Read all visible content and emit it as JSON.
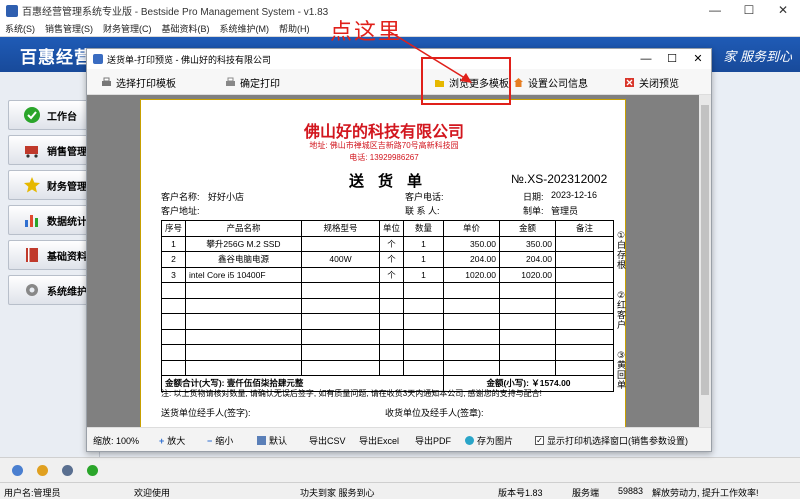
{
  "main_window": {
    "title": "百惠经营管理系统专业版 - Bestside Pro Management System - v1.83",
    "controls": {
      "minimize": "—",
      "maximize": "☐",
      "close": "✕"
    }
  },
  "main_menu": [
    "系统(S)",
    "销售管理(S)",
    "财务管理(C)",
    "基础资料(B)",
    "系统维护(M)",
    "帮助(H)"
  ],
  "banner": {
    "logo": "百惠经营",
    "slogan": "家 服务到心"
  },
  "sidebar": {
    "items": [
      {
        "label": "工作台",
        "icon": "check-icon",
        "color": "#2aa52a"
      },
      {
        "label": "销售管理",
        "icon": "cart-icon",
        "color": "#c0392b"
      },
      {
        "label": "财务管理",
        "icon": "star-icon",
        "color": "#e6b800"
      },
      {
        "label": "数据统计",
        "icon": "chart-icon",
        "color": "#2f6fd0"
      },
      {
        "label": "基础资料",
        "icon": "book-icon",
        "color": "#c0392b"
      },
      {
        "label": "系统维护",
        "icon": "gear-icon",
        "color": "#888888"
      }
    ]
  },
  "annotation": {
    "text": "点这里",
    "color": "#e0201a"
  },
  "dialog": {
    "title": "送货单-打印预览 - 佛山好的科技有限公司",
    "toolbar": {
      "select_template": "选择打印模板",
      "confirm_print": "确定打印",
      "browse_templates": "浏览更多模板",
      "company_settings": "设置公司信息",
      "close_preview": "关闭预览"
    },
    "footer": {
      "zoom": "缩放: 100%",
      "zoom_in": "放大",
      "zoom_out": "缩小",
      "default": "默认",
      "export_csv": "导出CSV",
      "export_excel": "导出Excel",
      "export_pdf": "导出PDF",
      "save_image": "存为图片",
      "show_printer": "显示打印机选择窗口(销售参数设置)"
    }
  },
  "invoice": {
    "company": "佛山好的科技有限公司",
    "address": "地址: 佛山市禅城区吉新路70号高新科技园",
    "phone": "电话: 13929986267",
    "title": "送货单",
    "number": "№.XS-202312002",
    "customer_name_label": "客户名称:",
    "customer_name": "好好小店",
    "customer_phone_label": "客户电话:",
    "date_label": "日期:",
    "date": "2023-12-16",
    "customer_address_label": "客户地址:",
    "contact_label": "联 系 人:",
    "maker_label": "制单:",
    "maker": "管理员",
    "columns": [
      "序号",
      "产品名称",
      "规格型号",
      "单位",
      "数量",
      "单价",
      "金额",
      "备注"
    ],
    "rows": [
      {
        "no": "1",
        "name": "攀升256G M.2 SSD",
        "spec": "",
        "unit": "个",
        "qty": "1",
        "price": "350.00",
        "amount": "350.00",
        "note": ""
      },
      {
        "no": "2",
        "name": "鑫谷电脑电源",
        "spec": "400W",
        "unit": "个",
        "qty": "1",
        "price": "204.00",
        "amount": "204.00",
        "note": ""
      },
      {
        "no": "3",
        "name": "intel Core i5 10400F",
        "spec": "",
        "unit": "个",
        "qty": "1",
        "price": "1020.00",
        "amount": "1020.00",
        "note": ""
      }
    ],
    "total_upper": "金额合计(大写): 壹仟伍佰柒拾肆元整",
    "total_lower": "金额(小写): ￥1574.00",
    "note": "注: 以上货物请核对数量, 请确认无误后签字, 如有质量问题, 请在收货3天内通知本公司, 感谢您的支持与配合!",
    "sender_sign": "送货单位经手人(签字):",
    "receiver_sign": "收货单位及经手人(签章):",
    "stubs": [
      "①白存根",
      "②红客户",
      "③黄回单"
    ]
  },
  "statusbar": {
    "user": "用户名:管理员",
    "welcome": "欢迎使用",
    "motto": "功夫到家 服务到心",
    "version": "版本号1.83",
    "edition_label": "服务端",
    "count": "59883",
    "slogan2": "解放劳动力, 提升工作效率!"
  }
}
